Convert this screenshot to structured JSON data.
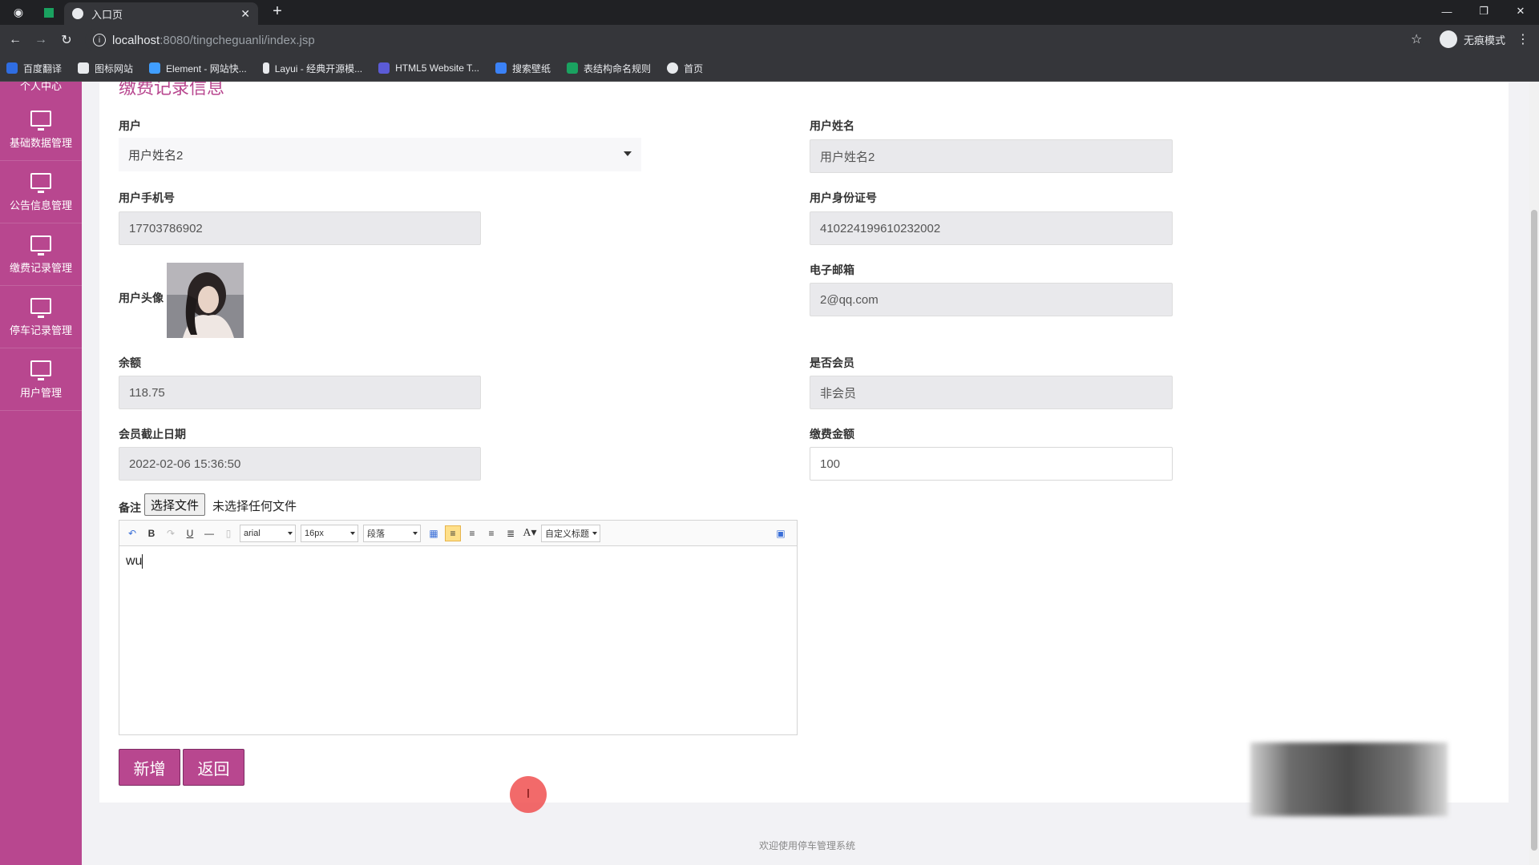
{
  "browser": {
    "tab_title": "入口页",
    "url_host": "localhost",
    "url_path": ":8080/tingcheguanli/index.jsp",
    "incognito_label": "无痕模式",
    "bookmarks": [
      {
        "label": "百度翻译",
        "color": "#2f6de1"
      },
      {
        "label": "图标网站",
        "color": "#e8eaed"
      },
      {
        "label": "Element - 网站快...",
        "color": "#409eff"
      },
      {
        "label": "Layui - 经典开源模...",
        "color": "#e8eaed"
      },
      {
        "label": "HTML5 Website T...",
        "color": "#5b5bd6"
      },
      {
        "label": "搜索壁纸",
        "color": "#3b82f6"
      },
      {
        "label": "表结构命名规则",
        "color": "#1aa260"
      },
      {
        "label": "首页",
        "color": "#e8eaed"
      }
    ]
  },
  "sidebar": {
    "top_partial": "个人中心",
    "items": [
      {
        "label": "基础数据管理"
      },
      {
        "label": "公告信息管理"
      },
      {
        "label": "缴费记录管理"
      },
      {
        "label": "停车记录管理"
      },
      {
        "label": "用户管理"
      }
    ]
  },
  "form": {
    "section_title": "缴费记录信息",
    "user_label": "用户",
    "user_selected": "用户姓名2",
    "user_name_label": "用户姓名",
    "user_name_value": "用户姓名2",
    "phone_label": "用户手机号",
    "phone_value": "17703786902",
    "id_label": "用户身份证号",
    "id_value": "410224199610232002",
    "avatar_label": "用户头像",
    "email_label": "电子邮箱",
    "email_value": "2@qq.com",
    "balance_label": "余额",
    "balance_value": "118.75",
    "member_label": "是否会员",
    "member_value": "非会员",
    "member_end_label": "会员截止日期",
    "member_end_value": "2022-02-06 15:36:50",
    "amount_label": "缴费金额",
    "amount_value": "100",
    "remark_label": "备注",
    "file_button": "选择文件",
    "file_status": "未选择任何文件",
    "editor": {
      "font": "arial",
      "size": "16px",
      "paragraph": "段落",
      "custom_title": "自定义标题",
      "content": "wu"
    },
    "add_button": "新增",
    "back_button": "返回"
  },
  "footer": {
    "text": "欢迎使用停车管理系统"
  }
}
